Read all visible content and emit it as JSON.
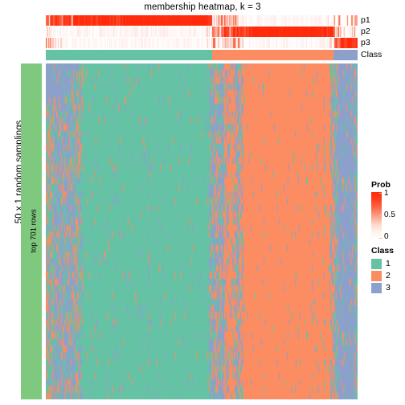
{
  "title": "membership heatmap, k = 3",
  "axes": {
    "left_label": "50 x 1 random samplings",
    "row_split_label": "top 701 rows"
  },
  "annotation_rows": [
    {
      "id": "p1",
      "label": "p1"
    },
    {
      "id": "p2",
      "label": "p2"
    },
    {
      "id": "p3",
      "label": "p3"
    },
    {
      "id": "class",
      "label": "Class"
    }
  ],
  "legends": {
    "prob": {
      "title": "Prob",
      "ticks": [
        "1",
        "0.5",
        "0"
      ],
      "color_low": "#FFFFFF",
      "color_mid": "#FB6A4A",
      "color_high": "#FF2A0A"
    },
    "class": {
      "title": "Class",
      "items": [
        {
          "label": "1",
          "color": "#66C2A5"
        },
        {
          "label": "2",
          "color": "#FC8D62"
        },
        {
          "label": "3",
          "color": "#8DA0CB"
        }
      ]
    }
  },
  "chart_data": {
    "type": "heatmap",
    "title": "membership heatmap, k = 3",
    "xlabel": "",
    "ylabel": "50 x 1 random samplings",
    "grid": false,
    "legend_position": "right",
    "n_rows": 50,
    "n_cols": 388,
    "row_split_label": "top 701 rows",
    "class_colors": {
      "1": "#66C2A5",
      "2": "#FC8D62",
      "3": "#8DA0CB"
    },
    "prob_colormap": {
      "0": "#FFFFFF",
      "0.5": "#FB6A4A",
      "1": "#FF2A0A"
    },
    "class_annotation_segments": [
      {
        "class": "1",
        "x_start": 0.0,
        "x_end": 0.533
      },
      {
        "class": "2",
        "x_start": 0.533,
        "x_end": 0.923
      },
      {
        "class": "3",
        "x_start": 0.923,
        "x_end": 1.0
      }
    ],
    "prob_annotation": {
      "p1": [
        {
          "x_start": 0.0,
          "x_end": 0.012,
          "value": 0.3
        },
        {
          "x_start": 0.012,
          "x_end": 0.022,
          "value": 0.92
        },
        {
          "x_start": 0.022,
          "x_end": 0.03,
          "value": 0.55
        },
        {
          "x_start": 0.03,
          "x_end": 0.042,
          "value": 0.98
        },
        {
          "x_start": 0.042,
          "x_end": 0.052,
          "value": 0.62
        },
        {
          "x_start": 0.052,
          "x_end": 0.062,
          "value": 0.99
        },
        {
          "x_start": 0.062,
          "x_end": 0.072,
          "value": 0.7
        },
        {
          "x_start": 0.072,
          "x_end": 0.082,
          "value": 1.0
        },
        {
          "x_start": 0.082,
          "x_end": 0.092,
          "value": 0.58
        },
        {
          "x_start": 0.092,
          "x_end": 0.105,
          "value": 0.96
        },
        {
          "x_start": 0.105,
          "x_end": 0.14,
          "value": 1.0
        },
        {
          "x_start": 0.14,
          "x_end": 0.15,
          "value": 0.88
        },
        {
          "x_start": 0.15,
          "x_end": 0.225,
          "value": 1.0
        },
        {
          "x_start": 0.225,
          "x_end": 0.235,
          "value": 0.9
        },
        {
          "x_start": 0.235,
          "x_end": 0.533,
          "value": 1.0
        },
        {
          "x_start": 0.533,
          "x_end": 0.56,
          "value": 0.12
        },
        {
          "x_start": 0.56,
          "x_end": 0.575,
          "value": 0.38
        },
        {
          "x_start": 0.575,
          "x_end": 0.59,
          "value": 0.1
        },
        {
          "x_start": 0.59,
          "x_end": 0.61,
          "value": 0.3
        },
        {
          "x_start": 0.61,
          "x_end": 0.923,
          "value": 0.02
        },
        {
          "x_start": 0.923,
          "x_end": 0.95,
          "value": 0.05
        },
        {
          "x_start": 0.95,
          "x_end": 0.965,
          "value": 0.22
        },
        {
          "x_start": 0.965,
          "x_end": 1.0,
          "value": 0.06
        }
      ],
      "p2": [
        {
          "x_start": 0.0,
          "x_end": 0.533,
          "value": 0.03
        },
        {
          "x_start": 0.533,
          "x_end": 0.56,
          "value": 0.45
        },
        {
          "x_start": 0.56,
          "x_end": 0.6,
          "value": 0.7
        },
        {
          "x_start": 0.6,
          "x_end": 0.64,
          "value": 0.95
        },
        {
          "x_start": 0.64,
          "x_end": 0.9,
          "value": 1.0
        },
        {
          "x_start": 0.9,
          "x_end": 0.923,
          "value": 0.92
        },
        {
          "x_start": 0.923,
          "x_end": 0.95,
          "value": 0.25
        },
        {
          "x_start": 0.95,
          "x_end": 1.0,
          "value": 0.05
        }
      ],
      "p3": [
        {
          "x_start": 0.0,
          "x_end": 0.03,
          "value": 0.35
        },
        {
          "x_start": 0.03,
          "x_end": 0.533,
          "value": 0.02
        },
        {
          "x_start": 0.533,
          "x_end": 0.62,
          "value": 0.2
        },
        {
          "x_start": 0.62,
          "x_end": 0.923,
          "value": 0.02
        },
        {
          "x_start": 0.923,
          "x_end": 0.945,
          "value": 0.55
        },
        {
          "x_start": 0.945,
          "x_end": 1.0,
          "value": 0.98
        }
      ]
    },
    "body_column_bands": [
      {
        "x_start": 0.0,
        "x_end": 0.012,
        "dominant_class": "3",
        "purity": 0.75
      },
      {
        "x_start": 0.012,
        "x_end": 0.105,
        "dominant_class": "3",
        "purity": 0.55
      },
      {
        "x_start": 0.105,
        "x_end": 0.533,
        "dominant_class": "1",
        "purity": 0.97
      },
      {
        "x_start": 0.533,
        "x_end": 0.56,
        "dominant_class": "2",
        "purity": 0.55
      },
      {
        "x_start": 0.56,
        "x_end": 0.62,
        "dominant_class": "2",
        "purity": 0.7
      },
      {
        "x_start": 0.62,
        "x_end": 0.923,
        "dominant_class": "2",
        "purity": 0.98
      },
      {
        "x_start": 0.923,
        "x_end": 1.0,
        "dominant_class": "3",
        "purity": 0.85
      }
    ]
  }
}
